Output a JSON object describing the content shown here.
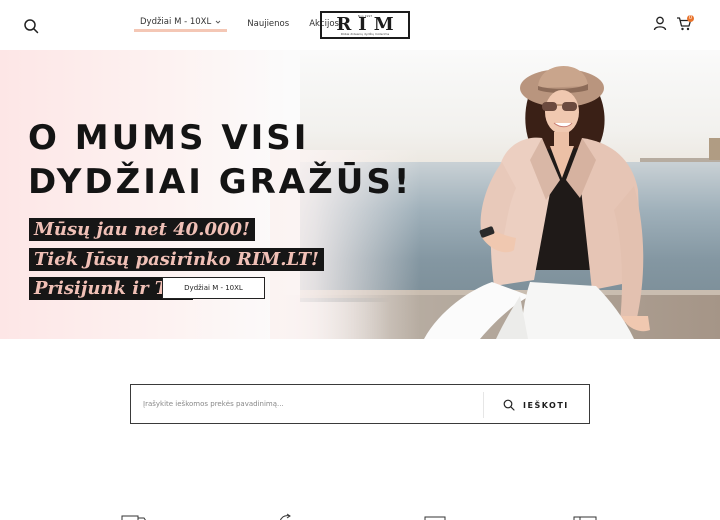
{
  "header": {
    "nav": [
      {
        "label": "Dydžiai M - 10XL",
        "icon": "chevron-down-icon"
      },
      {
        "label": "Naujienos"
      },
      {
        "label": "Akcijos"
      }
    ],
    "logo": {
      "word": "RIM",
      "tagline_top": "Nuo 1997",
      "tagline_bottom": "Rūbai didesnių dydžių moterims"
    },
    "icons": [
      "search-icon",
      "user-icon",
      "cart-icon"
    ],
    "cart_count": "0"
  },
  "hero": {
    "title_line1": "O MUMS VISI",
    "title_line2": "DYDŽIAI GRAŽŪS!",
    "tag1": "Mūsų jau net 40.000!",
    "tag2": "Tiek Jūsų pasirinko RIM.LT!",
    "tag3": "Prisijunk ir Tu!",
    "button": "Dydžiai M - 10XL"
  },
  "search": {
    "placeholder": "Įrašykite ieškomos prekės pavadinimą...",
    "button": "IEŠKOTI",
    "icon": "search-icon"
  },
  "features": {
    "icons": [
      "truck-icon",
      "return-icon",
      "card-icon",
      "package-icon"
    ]
  },
  "colors": {
    "accent_underline": "#f4c7b5",
    "badge": "#e8732c",
    "tag_bg": "#161616",
    "tag_text": "#f0c0b6"
  }
}
